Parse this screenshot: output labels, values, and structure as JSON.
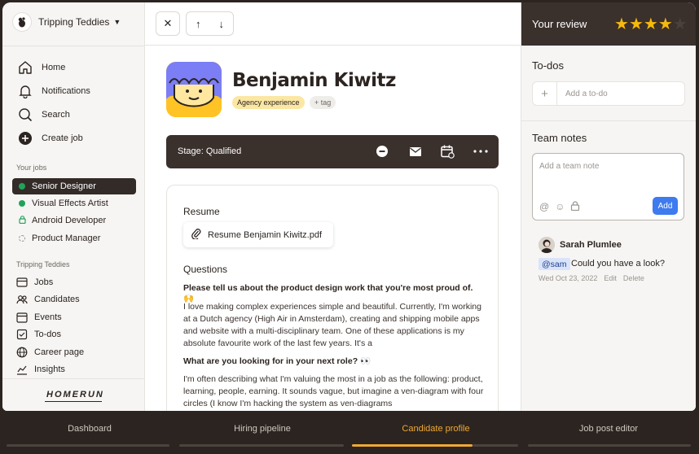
{
  "org": {
    "name": "Tripping Teddies",
    "logo_icon": "bear-icon"
  },
  "nav": [
    {
      "label": "Home",
      "icon": "home-icon"
    },
    {
      "label": "Notifications",
      "icon": "bell-icon"
    },
    {
      "label": "Search",
      "icon": "search-icon"
    },
    {
      "label": "Create job",
      "icon": "plus-circle-icon"
    }
  ],
  "jobs_section": {
    "title": "Your jobs",
    "items": [
      {
        "label": "Senior Designer",
        "status": "active"
      },
      {
        "label": "Visual Effects Artist",
        "status": "published"
      },
      {
        "label": "Android Developer",
        "status": "internal"
      },
      {
        "label": "Product Manager",
        "status": "draft"
      }
    ]
  },
  "company_section": {
    "title": "Tripping Teddies",
    "items": [
      {
        "label": "Jobs",
        "icon": "jobs-icon"
      },
      {
        "label": "Candidates",
        "icon": "people-icon"
      },
      {
        "label": "Events",
        "icon": "calendar-icon"
      },
      {
        "label": "To-dos",
        "icon": "checkbox-icon"
      },
      {
        "label": "Career page",
        "icon": "globe-icon"
      },
      {
        "label": "Insights",
        "icon": "chart-icon"
      }
    ]
  },
  "brand": "HOMERUN",
  "candidate": {
    "name": "Benjamin Kiwitz",
    "tag": "Agency experience",
    "add_tag": "+ tag",
    "stage": "Stage: Qualified"
  },
  "resume": {
    "heading": "Resume",
    "file": "Resume Benjamin Kiwitz.pdf"
  },
  "questions": {
    "heading": "Questions",
    "items": [
      {
        "q": "Please tell us about the product design work that you're most proud of. 🙌",
        "a": "I love making complex experiences simple and beautiful. Currently, I'm working at a Dutch agency (High Air in Amsterdam), creating and shipping mobile apps and website with a multi-disciplinary team. One of these applications is my absolute favourite work of the last few years. It's a"
      },
      {
        "q": "What are you looking for in your next role? 👀",
        "a": "I'm often describing what I'm valuing the most in a job as the following: product, learning, people, earning. It sounds vague, but imagine a ven-diagram with four circles (I know I'm hacking the system as ven-diagrams"
      }
    ]
  },
  "review": {
    "label": "Your review",
    "rating": 4,
    "max": 5
  },
  "todos": {
    "heading": "To-dos",
    "placeholder": "Add a to-do"
  },
  "notes": {
    "heading": "Team notes",
    "placeholder": "Add a team note",
    "add_label": "Add",
    "comment": {
      "author": "Sarah Plumlee",
      "mention": "@sam",
      "text": "Could you have a look?",
      "date": "Wed Oct 23, 2022",
      "edit": "Edit",
      "delete": "Delete"
    }
  },
  "tabs": [
    {
      "label": "Dashboard",
      "active": false
    },
    {
      "label": "Hiring pipeline",
      "active": false
    },
    {
      "label": "Candidate profile",
      "active": true
    },
    {
      "label": "Job post editor",
      "active": false
    }
  ],
  "colors": {
    "accent": "#f0a934",
    "dark": "#3a302c",
    "green": "#21a35a",
    "star": "#f6b90c",
    "blue": "#3d7bef"
  }
}
